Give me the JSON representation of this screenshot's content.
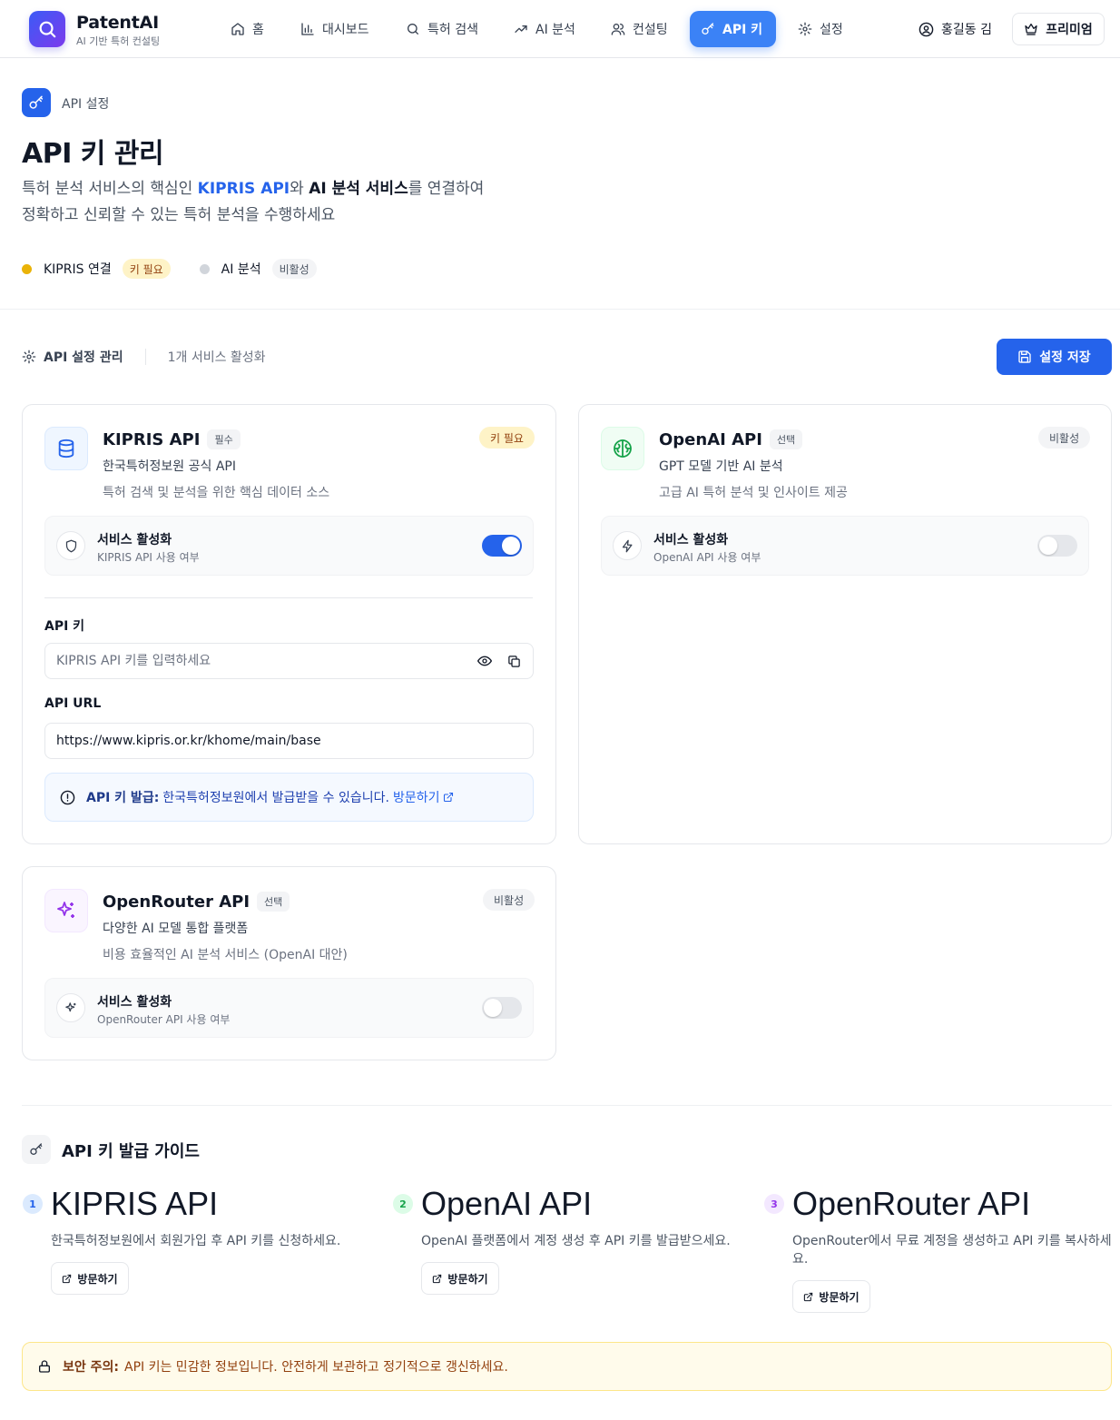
{
  "brand": {
    "title": "PatentAI",
    "subtitle": "AI 기반 특허 컨설팅"
  },
  "nav": {
    "items": [
      {
        "label": "홈",
        "icon": "home-icon"
      },
      {
        "label": "대시보드",
        "icon": "bar-chart-icon"
      },
      {
        "label": "특허 검색",
        "icon": "search-icon"
      },
      {
        "label": "AI 분석",
        "icon": "trending-up-icon"
      },
      {
        "label": "컨설팅",
        "icon": "users-icon"
      },
      {
        "label": "API 키",
        "icon": "key-icon",
        "active": true
      },
      {
        "label": "설정",
        "icon": "gear-icon"
      }
    ],
    "user_name": "홍길동 김",
    "premium_label": "프리미엄"
  },
  "hero": {
    "breadcrumb": "API 설정",
    "title": "API 키 관리",
    "desc_part1": "특허 분석 서비스의 핵심인 ",
    "desc_hl1": "KIPRIS API",
    "desc_part2": "와 ",
    "desc_hl2": "AI 분석 서비스",
    "desc_part3": "를 연결하여",
    "desc_line2": "정확하고 신뢰할 수 있는 특허 분석을 수행하세요",
    "status": [
      {
        "label": "KIPRIS 연결",
        "badge": "키 필요",
        "color": "#eab308"
      },
      {
        "label": "AI 분석",
        "badge": "비활성",
        "color": "#d1d5db"
      }
    ]
  },
  "toolbar": {
    "title": "API 설정 관리",
    "active_count": "1개 서비스 활성화",
    "save_label": "설정 저장"
  },
  "services": {
    "kipris": {
      "name": "KIPRIS API",
      "tag": "필수",
      "subtitle": "한국특허정보원 공식 API",
      "desc": "특허 검색 및 분석을 위한 핵심 데이터 소스",
      "badge": "키 필요",
      "toggle_title": "서비스 활성화",
      "toggle_sub": "KIPRIS API 사용 여부",
      "enabled": true,
      "api_key_label": "API 키",
      "api_key_placeholder": "KIPRIS API 키를 입력하세요",
      "api_key_value": "",
      "api_url_label": "API URL",
      "api_url_value": "https://www.kipris.or.kr/khome/main/base",
      "info_bold": "API 키 발급:",
      "info_text": "한국특허정보원에서 발급받을 수 있습니다.",
      "info_link": "방문하기"
    },
    "openai": {
      "name": "OpenAI API",
      "tag": "선택",
      "subtitle": "GPT 모델 기반 AI 분석",
      "desc": "고급 AI 특허 분석 및 인사이트 제공",
      "badge": "비활성",
      "toggle_title": "서비스 활성화",
      "toggle_sub": "OpenAI API 사용 여부",
      "enabled": false
    },
    "openrouter": {
      "name": "OpenRouter API",
      "tag": "선택",
      "subtitle": "다양한 AI 모델 통합 플랫폼",
      "desc": "비용 효율적인 AI 분석 서비스 (OpenAI 대안)",
      "badge": "비활성",
      "toggle_title": "서비스 활성화",
      "toggle_sub": "OpenRouter API 사용 여부",
      "enabled": false
    }
  },
  "guide": {
    "title": "API 키 발급 가이드",
    "steps": [
      {
        "num": "1",
        "title": "KIPRIS API",
        "desc": "한국특허정보원에서 회원가입 후 API 키를 신청하세요.",
        "button": "방문하기"
      },
      {
        "num": "2",
        "title": "OpenAI API",
        "desc": "OpenAI 플랫폼에서 계정 생성 후 API 키를 발급받으세요.",
        "button": "방문하기"
      },
      {
        "num": "3",
        "title": "OpenRouter API",
        "desc": "OpenRouter에서 무료 계정을 생성하고 API 키를 복사하세요.",
        "button": "방문하기"
      }
    ]
  },
  "security": {
    "bold": "보안 주의:",
    "text": "API 키는 민감한 정보입니다. 안전하게 보관하고 정기적으로 갱신하세요."
  },
  "colors": {
    "primary": "#2563eb",
    "nav_active": "#3b82f6",
    "warning_bg": "#fef3c7",
    "openai_green": "#16a34a",
    "openrouter_purple": "#9333ea"
  }
}
